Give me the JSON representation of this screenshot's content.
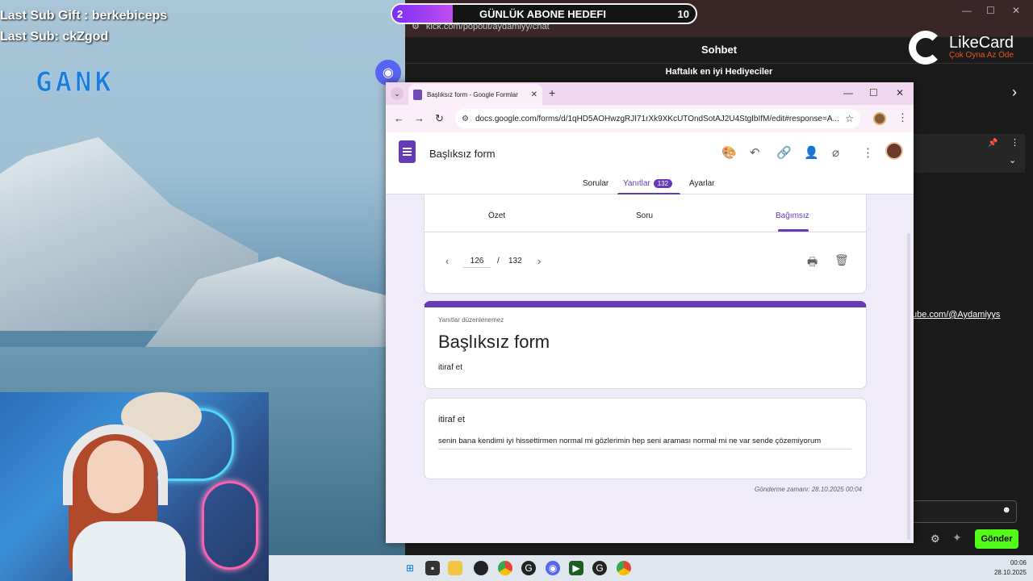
{
  "stream": {
    "last_sub_gift": "Last Sub Gift : berkebiceps",
    "last_sub": "Last Sub: ckZgod",
    "logo_text": "GANK",
    "discord_label": "Di"
  },
  "goal": {
    "current": "2",
    "title": "GÜNLÜK ABONE HEDEFI",
    "target": "10",
    "progress": 0.2
  },
  "chat": {
    "url": "kick.com/popout/aydamiyy/chat",
    "title": "Sohbet",
    "weekly_title": "Haftalık en iyi Hediyeciler",
    "youtube_link": "ube.com/@Aydamiyys",
    "send_label": "Gönder"
  },
  "likecard": {
    "name": "LikeCard",
    "tagline": "Çok Oyna  Az Öde"
  },
  "browser": {
    "tab_title": "Başlıksız form - Google Formlar",
    "url": "docs.google.com/forms/d/1qHD5AOHwzgRJI71rXk9XKcUTOndSotAJ2U4StgIbIfM/edit#response=A..."
  },
  "form_header": {
    "title": "Başlıksız form",
    "tabs": {
      "questions": "Sorular",
      "responses": "Yanıtlar",
      "responses_count": "132",
      "settings": "Ayarlar"
    }
  },
  "view_tabs": {
    "summary": "Özet",
    "question": "Soru",
    "individual": "Bağımsız"
  },
  "pager": {
    "current": "126",
    "separator": "/",
    "total": "132"
  },
  "form": {
    "no_edit_note": "Yanıtlar düzenlenemez",
    "title": "Başlıksız form",
    "description": "itiraf et"
  },
  "response": {
    "question": "itiraf et",
    "answer": "senin bana kendimi iyi hissettirmen normal mi gözlerimin hep seni araması normal mi ne var sende çözemiyorum",
    "submitted_at": "Gönderme zamanı: 28.10.2025 00:04"
  },
  "taskbar": {
    "time": "00:06",
    "date": "28.10.2025"
  },
  "colors": {
    "forms_purple": "#673ab7",
    "kick_green": "#53fc18",
    "content_bg": "#f0ebf8"
  }
}
